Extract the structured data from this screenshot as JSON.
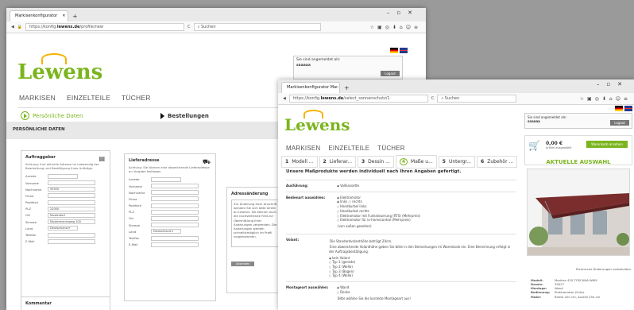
{
  "brand": {
    "logo_text": "Lewens",
    "primary_color": "#7ab51d",
    "accent_color": "#f6b200"
  },
  "window1": {
    "tab_title": "Markisenkonfigurator",
    "url_prefix": "https://konfig.",
    "url_domain": "lewens.de",
    "url_path": "/profile/new",
    "search_placeholder": "Suchen",
    "login": {
      "label": "Sie sind angemeldet als:",
      "user": "saaaaa",
      "button": "Logout"
    },
    "nav": [
      "MARKISEN",
      "EINZELTEILE",
      "TÜCHER"
    ],
    "step_active": "Persönliche Daten",
    "step_next": "Bestellungen",
    "section_title": "PERSÖNLICHE DATEN",
    "auftraggeber": {
      "title": "Auftraggeber",
      "desc": "Achtung: Ihre aktuelle Adresse ist notwendig der Bearbeitung und Bestätigung Ihres Aufträge.",
      "fields": [
        {
          "label": "Anrede",
          "value": ""
        },
        {
          "label": "Vorname",
          "value": ""
        },
        {
          "label": "Nachname",
          "value": "55555"
        },
        {
          "label": "Firma",
          "value": ""
        },
        {
          "label": "Postfach",
          "value": ""
        },
        {
          "label": "PLZ",
          "value": "22000"
        },
        {
          "label": "Ort",
          "value": "Musterdorf"
        },
        {
          "label": "Strasse",
          "value": "Mustermannsweg 100"
        },
        {
          "label": "Land",
          "value": "Deutschland ▾"
        },
        {
          "label": "Telefon",
          "value": ""
        },
        {
          "label": "E-Mail",
          "value": ""
        }
      ]
    },
    "lieferadresse": {
      "title": "Lieferadresse",
      "desc": "Achtung: Sie können eine abweichende Lieferadresse an Vorgabe festlegen.",
      "fields": [
        {
          "label": "Anrede",
          "value": ""
        },
        {
          "label": "Vorname",
          "value": ""
        },
        {
          "label": "Nachname",
          "value": ""
        },
        {
          "label": "Firma",
          "value": ""
        },
        {
          "label": "Postfach",
          "value": ""
        },
        {
          "label": "PLZ",
          "value": ""
        },
        {
          "label": "Ort",
          "value": ""
        },
        {
          "label": "Strasse",
          "value": ""
        },
        {
          "label": "Land",
          "value": "Deutschland ▾"
        },
        {
          "label": "Telefon",
          "value": ""
        },
        {
          "label": "E-Mail",
          "value": ""
        }
      ]
    },
    "adressaenderung": {
      "title": "Adressänderung",
      "text": "Zur Änderung Ihrer Anschrift wenden Sie sich bitte direkt an Lewens. Sie können auch die nachstehende Feld zur Übermittlung Ihrer Änderungen verwenden. Die Änderungen werden schnellstmöglich im Profil vorgenommen.",
      "button": "Absenden"
    },
    "kommentar": "Kommentar"
  },
  "window2": {
    "tab_title": "Markisenkonfigurator Mar...",
    "url_prefix": "https://konfig.",
    "url_domain": "lewens.de",
    "url_path": "/select_sonnenschutz/1",
    "search_placeholder": "Suchen",
    "login": {
      "label": "Sie sind angemeldet als:",
      "user": "saaaaa",
      "button": "Logout"
    },
    "nav": [
      "MARKISEN",
      "EINZELTEILE",
      "TÜCHER"
    ],
    "steps": [
      {
        "num": "1",
        "label": "Modell ..."
      },
      {
        "num": "2",
        "label": "Lieferar..."
      },
      {
        "num": "3",
        "label": "Dessin ..."
      },
      {
        "num": "4",
        "label": "Maße u..."
      },
      {
        "num": "5",
        "label": "Untergr..."
      },
      {
        "num": "6",
        "label": "Zubehör ..."
      }
    ],
    "heading": "Unsere Maßprodukte werden individuell nach Ihren Angaben gefertigt.",
    "rows": [
      {
        "label": "Ausführung:",
        "options": [
          {
            "text": "Vollkassette",
            "on": true
          }
        ]
      },
      {
        "label": "Bedienart auswählen:",
        "options": [
          {
            "text": "Elektromotor",
            "on": true
          },
          {
            "text": "links   ○ rechts",
            "on": true
          },
          {
            "text": "Handkurbel links",
            "on": false
          },
          {
            "text": "Handkurbel rechts",
            "on": false
          },
          {
            "text": "Elektromotor mit Funksteuerung (RTS) (Mehrpreis)",
            "on": false
          },
          {
            "text": "Elektromotor für io-homecontrol (Mehrpreis)",
            "on": false
          },
          {
            "text": "(von außen gesehen)",
            "on": null
          }
        ]
      },
      {
        "label": "Volant:",
        "options": [
          {
            "text": "Die Standardvolanthöhe beträgt 20cm.",
            "on": null
          },
          {
            "text": "Eine abweichende Volanthöhe geben Sie bitte in den Bemerkungen im Warenkorb ein. Eine Berechnung erfolgt in der Auftragsbestätigung.",
            "on": null
          },
          {
            "text": "kein Volant",
            "on": true
          },
          {
            "text": "Typ 1 (gerade)",
            "on": false
          },
          {
            "text": "Typ 2 (Welle)",
            "on": false
          },
          {
            "text": "Typ 3 (Bogen)",
            "on": false
          },
          {
            "text": "Typ 4 (Welle)",
            "on": false
          }
        ]
      },
      {
        "label": "Montageart auswählen:",
        "options": [
          {
            "text": "Wand",
            "on": true
          },
          {
            "text": "Decke",
            "on": false
          },
          {
            "text": "Bitte wählen Sie die korrekte Montageart aus!",
            "on": null
          }
        ]
      }
    ],
    "cart": {
      "price": "0,00 €",
      "price_note": "Artikel ausgewählt",
      "button": "Warenkorb ansehen"
    },
    "aktuell_title": "AKTUELLE AUSWAHL",
    "caption_note": "Technische Änderungen vorbehalten",
    "details": [
      {
        "k": "Modell:",
        "v": "Markise 420 TOSCANA WKM"
      },
      {
        "k": "Dessin:",
        "v": "39027"
      },
      {
        "k": "Montage:",
        "v": "Wand"
      },
      {
        "k": "Bedienung:",
        "v": "Elektromotor (links)"
      },
      {
        "k": "Maße:",
        "v": "Breite 420 cm, Ausfall 250 cm"
      }
    ]
  }
}
